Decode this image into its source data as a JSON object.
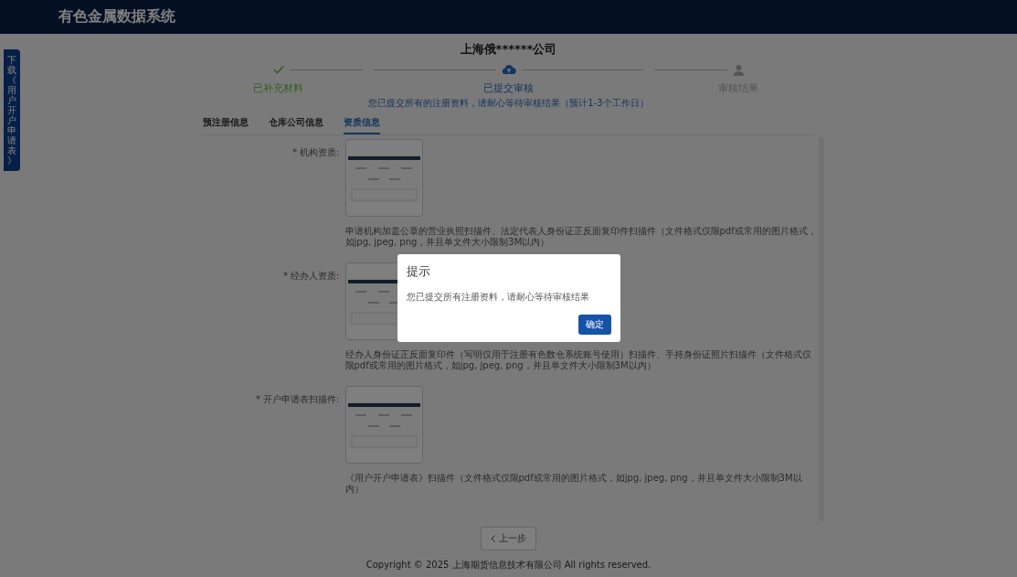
{
  "header": {
    "title": "有色金属数据系统"
  },
  "side_tab": {
    "label": "下载《用户开户申请表》"
  },
  "company": {
    "name": "上海俄******公司"
  },
  "steps": [
    {
      "title": "已补充材料",
      "done": true,
      "selected": false
    },
    {
      "title": "已提交审核",
      "done": false,
      "selected": true,
      "description": "您已提交所有的注册资料，请耐心等待审核结果（预计1-3个工作日）"
    },
    {
      "title": "审核结果",
      "done": false,
      "selected": false
    }
  ],
  "tabs": [
    {
      "label": "预注册信息",
      "selected": false
    },
    {
      "label": "仓库公司信息",
      "selected": false
    },
    {
      "label": "资质信息",
      "selected": true
    }
  ],
  "fields": [
    {
      "label": "* 机构资质:",
      "description": "申请机构加盖公章的营业执照扫描件、法定代表人身份证正反面复印件扫描件（文件格式仅限pdf或常用的图片格式，如jpg, jpeg, png，并且单文件大小限制3M以内）"
    },
    {
      "label": "* 经办人资质:",
      "description": "经办人身份证正反面复印件（写明仅用于注册有色数仓系统账号使用）扫描件、手持身份证照片扫描件（文件格式仅限pdf或常用的图片格式，如jpg, jpeg, png，并且单文件大小限制3M以内）"
    },
    {
      "label": "* 开户申请表扫描件:",
      "description": "《用户开户申请表》扫描件（文件格式仅限pdf或常用的图片格式，如jpg, jpeg, png，并且单文件大小限制3M以内）"
    }
  ],
  "back_button": {
    "label": "上一步"
  },
  "footer": {
    "text": "Copyright © 2025 上海期货信息技术有限公司 All rights reserved."
  },
  "dialog": {
    "title": "提示",
    "message": "您已提交所有注册资料，请耐心等待审核结果",
    "confirm": "确定"
  }
}
